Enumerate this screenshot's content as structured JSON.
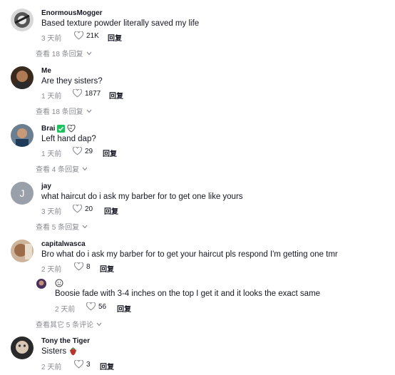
{
  "comments": [
    {
      "name": "EnormousMogger",
      "text": "Based texture powder literally saved my life",
      "time": "3 天前",
      "likes": "21K",
      "reply": "回复",
      "view_replies": "查看 18 条回复"
    },
    {
      "name": "Me",
      "text": "Are they sisters?",
      "time": "1 天前",
      "likes": "1877",
      "reply": "回复",
      "view_replies": "查看 18 条回复"
    },
    {
      "name": "Brai",
      "text": "Left hand dap?",
      "time": "1 天前",
      "likes": "29",
      "reply": "回复",
      "view_replies": "查看 4 条回复"
    },
    {
      "name": "jay",
      "avatar_letter": "J",
      "text": "what haircut do i ask my barber for to get one like yours",
      "time": "3 天前",
      "likes": "20",
      "reply": "回复",
      "view_replies": "查看 5 条回复"
    },
    {
      "name": "capitalwasca",
      "text": "Bro what do i ask my barber for to get your haircut pls respond I'm getting one tmr",
      "time": "2 天前",
      "likes": "8",
      "reply": "回复",
      "sub_reply": {
        "text": "Boosie fade with 3-4 inches on the top I get it and it looks the exact same",
        "time": "2 天前",
        "likes": "56",
        "reply": "回复"
      },
      "view_replies": "查看其它 5 条评论"
    },
    {
      "name": "Tony the Tiger",
      "text": "Sisters",
      "time": "2 天前",
      "likes": "3",
      "reply": "回复"
    }
  ],
  "colors": {
    "meta": "#8a8b91",
    "text": "#161823",
    "verified": "#20c060"
  }
}
